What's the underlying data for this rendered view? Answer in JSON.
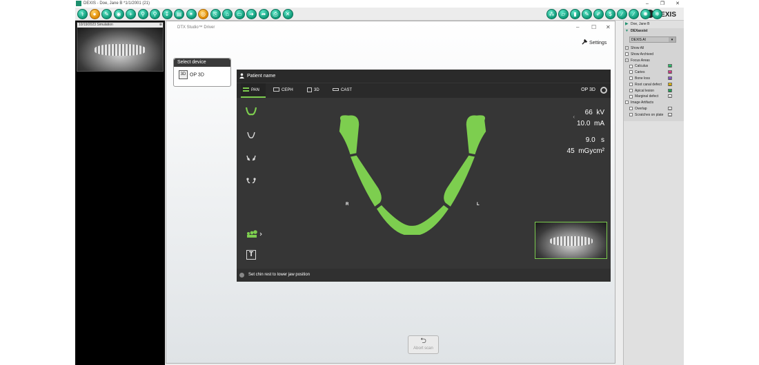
{
  "window": {
    "title": "DEXIS - Doe, Jane B *1/1/2001 (21)",
    "controls": [
      "–",
      "❐",
      "✕"
    ]
  },
  "toolbar": {
    "buttons": [
      {
        "name": "tooth-icon",
        "glyph": "⚕"
      },
      {
        "name": "patient-icon",
        "glyph": "●",
        "accent": "orange"
      },
      {
        "name": "edit-icon",
        "glyph": "✎"
      },
      {
        "name": "camera-icon",
        "glyph": "◉"
      },
      {
        "name": "add-icon",
        "glyph": "+"
      },
      {
        "name": "zoom-icon",
        "glyph": "⚲"
      },
      {
        "name": "zoom-plus-icon",
        "glyph": "⚲"
      },
      {
        "name": "implant-icon",
        "glyph": "↧"
      },
      {
        "name": "sensor-icon",
        "glyph": "▤"
      },
      {
        "name": "sparkle-icon",
        "glyph": "✶"
      },
      {
        "name": "ai-icon",
        "glyph": "◎",
        "accent": "orange"
      },
      {
        "name": "export-icon",
        "glyph": "⎘"
      },
      {
        "name": "home-icon",
        "glyph": "⌂"
      },
      {
        "name": "folder-icon",
        "glyph": "▭"
      },
      {
        "name": "send-icon",
        "glyph": "➜"
      },
      {
        "name": "share-icon",
        "glyph": "➦"
      },
      {
        "name": "print-icon",
        "glyph": "⎙"
      },
      {
        "name": "close-icon",
        "glyph": "✕"
      }
    ],
    "right_buttons": [
      {
        "name": "network-icon",
        "glyph": "⁂"
      },
      {
        "name": "ruler-icon",
        "glyph": "▱"
      },
      {
        "name": "implant-tool-icon",
        "glyph": "▮"
      },
      {
        "name": "pen-icon",
        "glyph": "✎"
      },
      {
        "name": "draw-icon",
        "glyph": "✐"
      },
      {
        "name": "dollar-icon",
        "glyph": "$"
      },
      {
        "name": "brush-icon",
        "glyph": "∕"
      },
      {
        "name": "measure-icon",
        "glyph": "∕"
      },
      {
        "name": "settings-icon",
        "glyph": "✺"
      },
      {
        "name": "snowflake-icon",
        "glyph": "❄"
      }
    ],
    "logo_text": "DEXIS"
  },
  "thumbnail": {
    "caption": "10/19/2023 Simulation",
    "close": "⊗"
  },
  "dialog": {
    "title": "DTX Studio™ Driver",
    "controls": [
      "–",
      "☐",
      "✕"
    ],
    "settings_label": "Settings",
    "select_device": {
      "header": "Select device",
      "device": "OP 3D",
      "device_glyph": "3D"
    },
    "screen": {
      "patient_label": "Patient name",
      "tabs": [
        {
          "label": "PAN",
          "active": true
        },
        {
          "label": "CEPH",
          "active": false
        },
        {
          "label": "3D",
          "active": false
        },
        {
          "label": "CAST",
          "active": false
        }
      ],
      "model": "OP 3D",
      "kv_value": "66",
      "kv_unit": "kV",
      "ma_value": "10.0",
      "ma_unit": "mA",
      "s_value": "9.0",
      "s_unit": "s",
      "dose_value": "45",
      "dose_unit": "mGycm²",
      "chevron": "‹",
      "left_label": "R",
      "right_label": "L",
      "t_label": "T",
      "status": "Set chin rest to lower jaw position",
      "accent_color": "#7dce4f"
    },
    "abort_label": "Abort scan",
    "abort_glyph": "⮌"
  },
  "right_panel": {
    "patient": "Doe, Jane B",
    "section": "DEXassist",
    "ai_select": "DEXIS AI",
    "rows": [
      {
        "label": "Show All",
        "checked": true,
        "indent": 1
      },
      {
        "label": "Show Archived",
        "checked": false,
        "indent": 1
      },
      {
        "label": "Focus Areas",
        "checked": true,
        "indent": 1
      },
      {
        "label": "Calculus",
        "checked": false,
        "indent": 2,
        "badge": "0",
        "badge_color": "#2ecc71"
      },
      {
        "label": "Caries",
        "checked": false,
        "indent": 2,
        "badge": "0",
        "badge_color": "#e84393"
      },
      {
        "label": "Bone loss",
        "checked": false,
        "indent": 2,
        "badge": "0",
        "badge_color": "#8e5bd6"
      },
      {
        "label": "Root canal defect",
        "checked": false,
        "indent": 2,
        "badge": "0",
        "badge_color": "#f1c40f"
      },
      {
        "label": "Apical lesion",
        "checked": false,
        "indent": 2,
        "badge": "0",
        "badge_color": "#27ae60"
      },
      {
        "label": "Marginal defect",
        "checked": false,
        "indent": 2,
        "badge": "0",
        "badge_color": "#ffffff"
      },
      {
        "label": "Image Artifacts",
        "checked": false,
        "indent": 1
      },
      {
        "label": "Overlap",
        "checked": false,
        "indent": 2,
        "badge": "0",
        "badge_color": "#ffffff"
      },
      {
        "label": "Scratches on plate",
        "checked": false,
        "indent": 2,
        "badge": "0",
        "badge_color": "#ffffff"
      }
    ]
  }
}
